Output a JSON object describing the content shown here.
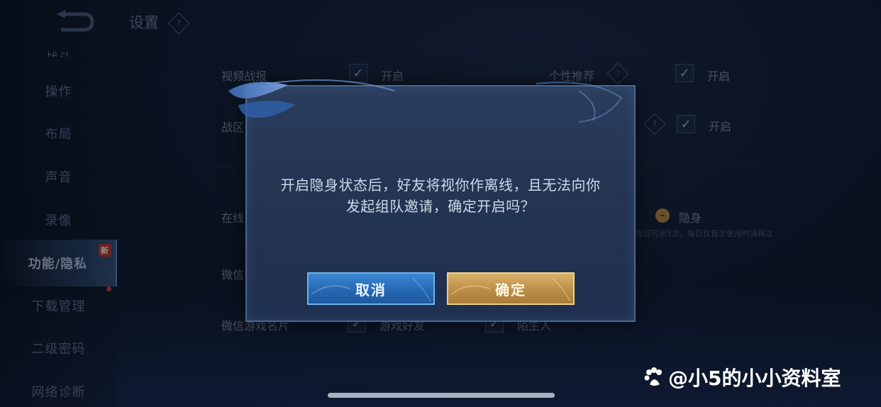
{
  "header": {
    "title": "设置",
    "help_glyph": "?"
  },
  "sidebar": {
    "items": [
      {
        "label": "战斗",
        "partial": true
      },
      {
        "label": "操作"
      },
      {
        "label": "布局"
      },
      {
        "label": "声音"
      },
      {
        "label": "录像"
      },
      {
        "label": "功能/隐私",
        "active": true,
        "badge": "新"
      },
      {
        "label": "下载管理",
        "dot": true
      },
      {
        "label": "二级密码"
      },
      {
        "label": "网络诊断"
      }
    ]
  },
  "settings": {
    "video_report": {
      "label": "视频战报",
      "option": "开启",
      "checked": true
    },
    "personal_recommend": {
      "label": "个性推荐",
      "option": "开启",
      "checked": true
    },
    "battle_row": {
      "label": "战区",
      "option": "开启",
      "checked": true
    },
    "online_status": {
      "label": "在线",
      "option": "隐身",
      "icon_glyph": "–",
      "tip": "每日可用5次，每日仅首次使用时消耗次"
    },
    "wechat_row": {
      "label": "微信"
    },
    "wechat_card": {
      "label": "微信游戏名片",
      "option1": "游戏好友",
      "option2": "陌生人"
    }
  },
  "dialog": {
    "message_line1": "开启隐身状态后，好友将视你作离线，且无法向你",
    "message_line2": "发起组队邀请，确定开启吗？",
    "cancel_label": "取消",
    "confirm_label": "确定"
  },
  "watermark": {
    "text": "@小5的小小资料室"
  },
  "colors": {
    "cancel_button": "#2f7bc8",
    "confirm_button": "#c9a05a",
    "dialog_bg": "#27395a",
    "accent": "#5d86c2"
  }
}
